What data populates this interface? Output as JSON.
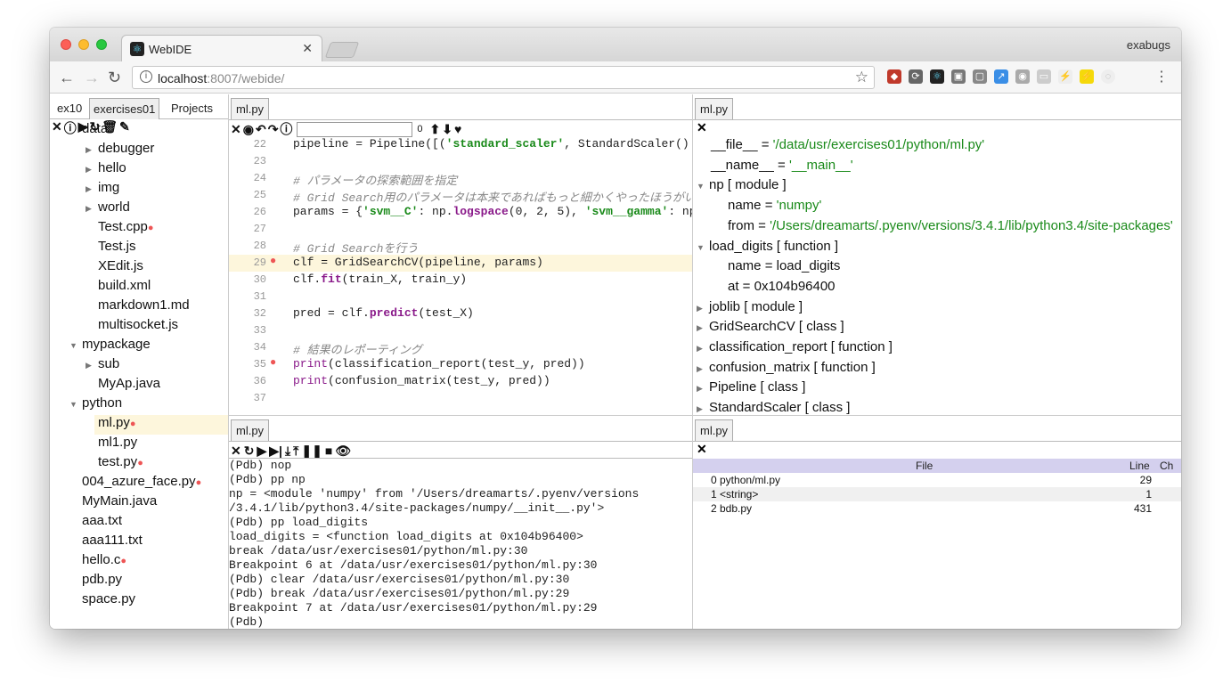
{
  "browser": {
    "tab_title": "WebIDE",
    "profile": "exabugs",
    "url_host": "localhost",
    "url_rest": ":8007/webide/"
  },
  "left": {
    "tabs": [
      "ex10",
      "exercises01",
      "Projects"
    ],
    "tree": [
      {
        "label": "data",
        "indent": 1,
        "arrow": "",
        "dot": false
      },
      {
        "label": "debugger",
        "indent": 2,
        "arrow": "▶",
        "dot": false
      },
      {
        "label": "hello",
        "indent": 2,
        "arrow": "▶",
        "dot": false
      },
      {
        "label": "img",
        "indent": 2,
        "arrow": "▶",
        "dot": false
      },
      {
        "label": "world",
        "indent": 2,
        "arrow": "▶",
        "dot": false
      },
      {
        "label": "Test.cpp",
        "indent": 2,
        "arrow": "",
        "dot": true
      },
      {
        "label": "Test.js",
        "indent": 2,
        "arrow": "",
        "dot": false
      },
      {
        "label": "XEdit.js",
        "indent": 2,
        "arrow": "",
        "dot": false
      },
      {
        "label": "build.xml",
        "indent": 2,
        "arrow": "",
        "dot": false
      },
      {
        "label": "markdown1.md",
        "indent": 2,
        "arrow": "",
        "dot": false
      },
      {
        "label": "multisocket.js",
        "indent": 2,
        "arrow": "",
        "dot": false
      },
      {
        "label": "mypackage",
        "indent": 1,
        "arrow": "▼",
        "dot": false
      },
      {
        "label": "sub",
        "indent": 2,
        "arrow": "▶",
        "dot": false
      },
      {
        "label": "MyAp.java",
        "indent": 2,
        "arrow": "",
        "dot": false
      },
      {
        "label": "python",
        "indent": 1,
        "arrow": "▼",
        "dot": false
      },
      {
        "label": "ml.py",
        "indent": 2,
        "arrow": "",
        "dot": true
      },
      {
        "label": "ml1.py",
        "indent": 2,
        "arrow": "",
        "dot": false
      },
      {
        "label": "test.py",
        "indent": 2,
        "arrow": "",
        "dot": true
      },
      {
        "label": "004_azure_face.py",
        "indent": 1,
        "arrow": "",
        "dot": true
      },
      {
        "label": "MyMain.java",
        "indent": 1,
        "arrow": "",
        "dot": false
      },
      {
        "label": "aaa.txt",
        "indent": 1,
        "arrow": "",
        "dot": false
      },
      {
        "label": "aaa111.txt",
        "indent": 1,
        "arrow": "",
        "dot": false
      },
      {
        "label": "hello.c",
        "indent": 1,
        "arrow": "",
        "dot": true
      },
      {
        "label": "pdb.py",
        "indent": 1,
        "arrow": "",
        "dot": false
      },
      {
        "label": "space.py",
        "indent": 1,
        "arrow": "",
        "dot": false
      }
    ]
  },
  "editor": {
    "tab": "ml.py",
    "search_count": "0",
    "lines": [
      {
        "n": "22",
        "bp": false,
        "hl": false,
        "html": "pipeline = Pipeline([(<span class='st'>'standard_scaler'</span>, StandardScaler()"
      },
      {
        "n": "23",
        "bp": false,
        "hl": false,
        "html": ""
      },
      {
        "n": "24",
        "bp": false,
        "hl": false,
        "html": "<span class='cm'># パラメータの探索範囲を指定</span>"
      },
      {
        "n": "25",
        "bp": false,
        "hl": false,
        "html": "<span class='cm'># Grid Search用のパラメータは本来であればもっと細かくやったほうがいい</span>"
      },
      {
        "n": "26",
        "bp": false,
        "hl": false,
        "html": "params = {<span class='st'>'svm__C'</span>: np.<span class='fn'>logspace</span>(0, 2, 5), <span class='st'>'svm__gamma'</span>: np"
      },
      {
        "n": "27",
        "bp": false,
        "hl": false,
        "html": ""
      },
      {
        "n": "28",
        "bp": false,
        "hl": false,
        "html": "<span class='cm'># Grid Searchを行う</span>"
      },
      {
        "n": "29",
        "bp": true,
        "hl": true,
        "html": "clf = GridSearchCV(pipeline, params)"
      },
      {
        "n": "30",
        "bp": false,
        "hl": false,
        "html": "clf.<span class='fn'>fit</span>(train_X, train_y)"
      },
      {
        "n": "31",
        "bp": false,
        "hl": false,
        "html": ""
      },
      {
        "n": "32",
        "bp": false,
        "hl": false,
        "html": "pred = clf.<span class='fn'>predict</span>(test_X)"
      },
      {
        "n": "33",
        "bp": false,
        "hl": false,
        "html": ""
      },
      {
        "n": "34",
        "bp": false,
        "hl": false,
        "html": "<span class='cm'># 結果のレポーティング</span>"
      },
      {
        "n": "35",
        "bp": true,
        "hl": false,
        "html": "<span class='kw'>print</span>(classification_report(test_y, pred))"
      },
      {
        "n": "36",
        "bp": false,
        "hl": false,
        "html": "<span class='kw'>print</span>(confusion_matrix(test_y, pred))"
      },
      {
        "n": "37",
        "bp": false,
        "hl": false,
        "html": ""
      }
    ]
  },
  "vars": {
    "tab": "ml.py",
    "rows": [
      {
        "indent": 1,
        "arrow": "",
        "key": "__file__ = ",
        "val": "'/data/usr/exercises01/python/ml.py'",
        "str": true
      },
      {
        "indent": 1,
        "arrow": "",
        "key": "__name__ = ",
        "val": "'__main__'",
        "str": true
      },
      {
        "indent": 0,
        "arrow": "▼",
        "key": "np [ module ]",
        "val": "",
        "str": false
      },
      {
        "indent": 2,
        "arrow": "",
        "key": "name = ",
        "val": "'numpy'",
        "str": true
      },
      {
        "indent": 2,
        "arrow": "",
        "key": "from = ",
        "val": "'/Users/dreamarts/.pyenv/versions/3.4.1/lib/python3.4/site-packages'",
        "str": true
      },
      {
        "indent": 0,
        "arrow": "▼",
        "key": "load_digits [ function ]",
        "val": "",
        "str": false
      },
      {
        "indent": 2,
        "arrow": "",
        "key": "name = load_digits",
        "val": "",
        "str": false
      },
      {
        "indent": 2,
        "arrow": "",
        "key": "at = 0x104b96400",
        "val": "",
        "str": false
      },
      {
        "indent": 0,
        "arrow": "▶",
        "key": "joblib [ module ]",
        "val": "",
        "str": false
      },
      {
        "indent": 0,
        "arrow": "▶",
        "key": "GridSearchCV [ class ]",
        "val": "",
        "str": false
      },
      {
        "indent": 0,
        "arrow": "▶",
        "key": "classification_report [ function ]",
        "val": "",
        "str": false
      },
      {
        "indent": 0,
        "arrow": "▶",
        "key": "confusion_matrix [ function ]",
        "val": "",
        "str": false
      },
      {
        "indent": 0,
        "arrow": "▶",
        "key": "Pipeline [ class ]",
        "val": "",
        "str": false
      },
      {
        "indent": 0,
        "arrow": "▶",
        "key": "StandardScaler [ class ]",
        "val": "",
        "str": false
      }
    ]
  },
  "console": {
    "tab": "ml.py",
    "lines": [
      "(Pdb) nop",
      "(Pdb) pp np",
      "np = <module 'numpy' from '/Users/dreamarts/.pyenv/versions",
      "/3.4.1/lib/python3.4/site-packages/numpy/__init__.py'>",
      "(Pdb) pp load_digits",
      "load_digits = <function load_digits at 0x104b96400>",
      "break /data/usr/exercises01/python/ml.py:30",
      "Breakpoint 6 at /data/usr/exercises01/python/ml.py:30",
      "(Pdb) clear /data/usr/exercises01/python/ml.py:30",
      "(Pdb) break /data/usr/exercises01/python/ml.py:29",
      "Breakpoint 7 at /data/usr/exercises01/python/ml.py:29",
      "(Pdb)"
    ]
  },
  "stack": {
    "tab": "ml.py",
    "headers": {
      "file": "File",
      "line": "Line",
      "ch": "Ch"
    },
    "rows": [
      {
        "file": "0 python/ml.py",
        "line": "29"
      },
      {
        "file": "1 <string>",
        "line": "1"
      },
      {
        "file": "2 bdb.py",
        "line": "431"
      }
    ]
  }
}
